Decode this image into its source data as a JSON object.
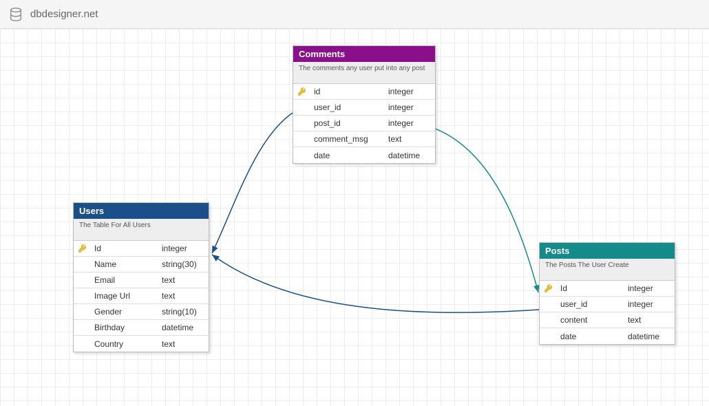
{
  "header": {
    "site_name": "dbdesigner.net"
  },
  "tables": {
    "users": {
      "title": "Users",
      "description": "The Table For All Users",
      "header_color": "#1b4f8a",
      "columns": [
        {
          "key": true,
          "name": "Id",
          "type": "integer"
        },
        {
          "key": false,
          "name": "Name",
          "type": "string(30)"
        },
        {
          "key": false,
          "name": "Email",
          "type": "text"
        },
        {
          "key": false,
          "name": "Image Url",
          "type": "text"
        },
        {
          "key": false,
          "name": "Gender",
          "type": "string(10)"
        },
        {
          "key": false,
          "name": "Birthday",
          "type": "datetime"
        },
        {
          "key": false,
          "name": "Country",
          "type": "text"
        }
      ]
    },
    "comments": {
      "title": "Comments",
      "description": "The comments any user put into any post",
      "header_color": "#8a0f8a",
      "columns": [
        {
          "key": true,
          "name": "id",
          "type": "integer"
        },
        {
          "key": false,
          "name": "user_id",
          "type": "integer"
        },
        {
          "key": false,
          "name": "post_id",
          "type": "integer"
        },
        {
          "key": false,
          "name": "comment_msg",
          "type": "text"
        },
        {
          "key": false,
          "name": "date",
          "type": "datetime"
        }
      ]
    },
    "posts": {
      "title": "Posts",
      "description": "The Posts The User Create",
      "header_color": "#148a8a",
      "columns": [
        {
          "key": true,
          "name": "Id",
          "type": "integer"
        },
        {
          "key": false,
          "name": "user_id",
          "type": "integer"
        },
        {
          "key": false,
          "name": "content",
          "type": "text"
        },
        {
          "key": false,
          "name": "date",
          "type": "datetime"
        }
      ]
    }
  },
  "relationships": [
    {
      "from": "comments.user_id",
      "to": "users.Id",
      "color": "#1b4f8a"
    },
    {
      "from": "posts.user_id",
      "to": "users.Id",
      "color": "#1b4f8a"
    },
    {
      "from": "comments.post_id",
      "to": "posts.Id",
      "color": "#148a8a"
    }
  ]
}
